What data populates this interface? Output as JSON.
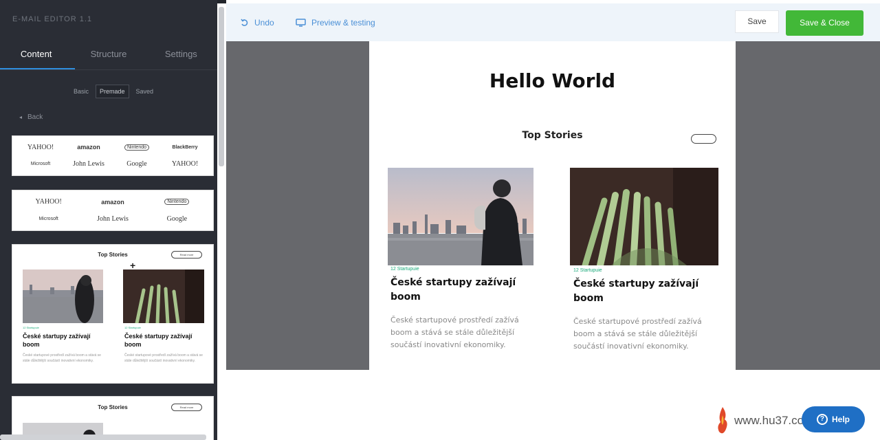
{
  "app": {
    "title": "E-MAIL EDITOR 1.1"
  },
  "sidebar": {
    "tabs": [
      {
        "label": "Content",
        "active": true
      },
      {
        "label": "Structure",
        "active": false
      },
      {
        "label": "Settings",
        "active": false
      }
    ],
    "segments": [
      {
        "label": "Basic",
        "active": false
      },
      {
        "label": "Premade",
        "active": true
      },
      {
        "label": "Saved",
        "active": false
      }
    ],
    "back_label": "Back",
    "logo_row1": [
      "YAHOO!",
      "amazon",
      "Nintendo",
      "BlackBerry",
      "Microsoft",
      "John Lewis",
      "Google",
      "YAHOO!"
    ],
    "logo_row2": [
      "YAHOO!",
      "amazon",
      "Nintendo",
      "Microsoft",
      "John Lewis",
      "Google"
    ],
    "template": {
      "title": "Top Stories",
      "pill": "Read more",
      "plus": "+",
      "category": "12 Startupuie",
      "heading": "České startupy zažívají boom",
      "body": "České startupové prostředí zažívá boom a stává se stále důležitější součástí inovativní ekonomiky."
    },
    "template2": {
      "title": "Top Stories",
      "pill": "Read more"
    }
  },
  "toolbar": {
    "undo_label": "Undo",
    "preview_label": "Preview & testing",
    "save_label": "Save",
    "save_close_label": "Save & Close"
  },
  "email": {
    "title": "Hello World",
    "section": "Top Stories",
    "stories": [
      {
        "category": "12 Startupuie",
        "heading": "České startupy zažívají boom",
        "body": "České startupové prostředí zažívá boom a stává se stále důležitější součástí inovativní ekonomiky."
      },
      {
        "category": "12 Startupuie",
        "heading": "České startupy zažívají boom",
        "body": "České startupové prostředí zažívá boom a stává se stále důležitější součástí inovativní ekonomiky."
      }
    ]
  },
  "help": {
    "label": "Help",
    "icon": "question-icon"
  },
  "watermark": {
    "text": "www.hu37.com"
  },
  "colors": {
    "accent_green": "#42b838",
    "link_blue": "#4a8fd6",
    "help_blue": "#1f6fc5",
    "sidebar_bg": "#2a2d35",
    "category_green": "#19a97a"
  }
}
